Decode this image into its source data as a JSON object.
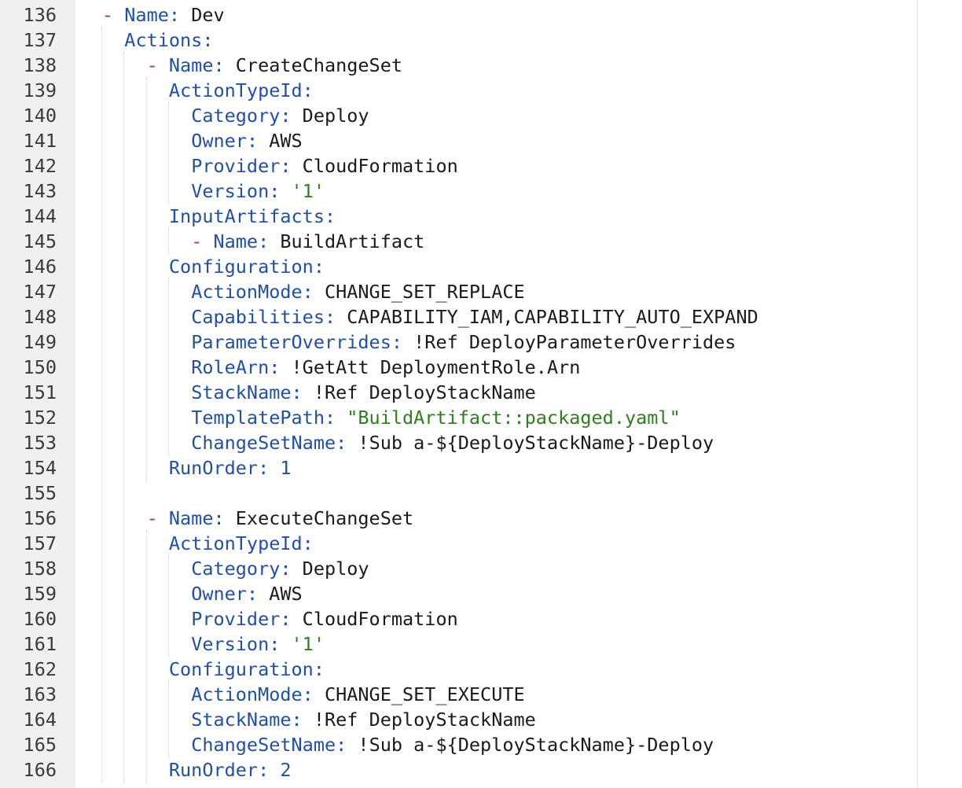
{
  "editor": {
    "lines": [
      {
        "number": "136",
        "indent": "",
        "dash": "- ",
        "key": "Name",
        "colon": ": ",
        "value": "Dev",
        "kind": "val"
      },
      {
        "number": "137",
        "indent": "  ",
        "dash": "",
        "key": "Actions",
        "colon": ":",
        "value": "",
        "kind": "val"
      },
      {
        "number": "138",
        "indent": "    ",
        "dash": "- ",
        "key": "Name",
        "colon": ": ",
        "value": "CreateChangeSet",
        "kind": "val"
      },
      {
        "number": "139",
        "indent": "      ",
        "dash": "",
        "key": "ActionTypeId",
        "colon": ":",
        "value": "",
        "kind": "val"
      },
      {
        "number": "140",
        "indent": "        ",
        "dash": "",
        "key": "Category",
        "colon": ": ",
        "value": "Deploy",
        "kind": "val"
      },
      {
        "number": "141",
        "indent": "        ",
        "dash": "",
        "key": "Owner",
        "colon": ": ",
        "value": "AWS",
        "kind": "val"
      },
      {
        "number": "142",
        "indent": "        ",
        "dash": "",
        "key": "Provider",
        "colon": ": ",
        "value": "CloudFormation",
        "kind": "val"
      },
      {
        "number": "143",
        "indent": "        ",
        "dash": "",
        "key": "Version",
        "colon": ": ",
        "value": "'1'",
        "kind": "str"
      },
      {
        "number": "144",
        "indent": "      ",
        "dash": "",
        "key": "InputArtifacts",
        "colon": ":",
        "value": "",
        "kind": "val"
      },
      {
        "number": "145",
        "indent": "        ",
        "dash": "- ",
        "key": "Name",
        "colon": ": ",
        "value": "BuildArtifact",
        "kind": "val"
      },
      {
        "number": "146",
        "indent": "      ",
        "dash": "",
        "key": "Configuration",
        "colon": ":",
        "value": "",
        "kind": "val"
      },
      {
        "number": "147",
        "indent": "        ",
        "dash": "",
        "key": "ActionMode",
        "colon": ": ",
        "value": "CHANGE_SET_REPLACE",
        "kind": "val"
      },
      {
        "number": "148",
        "indent": "        ",
        "dash": "",
        "key": "Capabilities",
        "colon": ": ",
        "value": "CAPABILITY_IAM,CAPABILITY_AUTO_EXPAND",
        "kind": "val"
      },
      {
        "number": "149",
        "indent": "        ",
        "dash": "",
        "key": "ParameterOverrides",
        "colon": ": ",
        "value": "!Ref DeployParameterOverrides",
        "kind": "val"
      },
      {
        "number": "150",
        "indent": "        ",
        "dash": "",
        "key": "RoleArn",
        "colon": ": ",
        "value": "!GetAtt DeploymentRole.Arn",
        "kind": "val"
      },
      {
        "number": "151",
        "indent": "        ",
        "dash": "",
        "key": "StackName",
        "colon": ": ",
        "value": "!Ref DeployStackName",
        "kind": "val"
      },
      {
        "number": "152",
        "indent": "        ",
        "dash": "",
        "key": "TemplatePath",
        "colon": ": ",
        "value": "\"BuildArtifact::packaged.yaml\"",
        "kind": "str"
      },
      {
        "number": "153",
        "indent": "        ",
        "dash": "",
        "key": "ChangeSetName",
        "colon": ": ",
        "value": "!Sub a-${DeployStackName}-Deploy",
        "kind": "val"
      },
      {
        "number": "154",
        "indent": "      ",
        "dash": "",
        "key": "RunOrder",
        "colon": ": ",
        "value": "1",
        "kind": "num"
      },
      {
        "number": "155",
        "indent": "",
        "dash": "",
        "key": "",
        "colon": "",
        "value": "",
        "kind": "val"
      },
      {
        "number": "156",
        "indent": "    ",
        "dash": "- ",
        "key": "Name",
        "colon": ": ",
        "value": "ExecuteChangeSet",
        "kind": "val"
      },
      {
        "number": "157",
        "indent": "      ",
        "dash": "",
        "key": "ActionTypeId",
        "colon": ":",
        "value": "",
        "kind": "val"
      },
      {
        "number": "158",
        "indent": "        ",
        "dash": "",
        "key": "Category",
        "colon": ": ",
        "value": "Deploy",
        "kind": "val"
      },
      {
        "number": "159",
        "indent": "        ",
        "dash": "",
        "key": "Owner",
        "colon": ": ",
        "value": "AWS",
        "kind": "val"
      },
      {
        "number": "160",
        "indent": "        ",
        "dash": "",
        "key": "Provider",
        "colon": ": ",
        "value": "CloudFormation",
        "kind": "val"
      },
      {
        "number": "161",
        "indent": "        ",
        "dash": "",
        "key": "Version",
        "colon": ": ",
        "value": "'1'",
        "kind": "str"
      },
      {
        "number": "162",
        "indent": "      ",
        "dash": "",
        "key": "Configuration",
        "colon": ":",
        "value": "",
        "kind": "val"
      },
      {
        "number": "163",
        "indent": "        ",
        "dash": "",
        "key": "ActionMode",
        "colon": ": ",
        "value": "CHANGE_SET_EXECUTE",
        "kind": "val"
      },
      {
        "number": "164",
        "indent": "        ",
        "dash": "",
        "key": "StackName",
        "colon": ": ",
        "value": "!Ref DeployStackName",
        "kind": "val"
      },
      {
        "number": "165",
        "indent": "        ",
        "dash": "",
        "key": "ChangeSetName",
        "colon": ": ",
        "value": "!Sub a-${DeployStackName}-Deploy",
        "kind": "val"
      },
      {
        "number": "166",
        "indent": "      ",
        "dash": "",
        "key": "RunOrder",
        "colon": ": ",
        "value": "2",
        "kind": "num"
      }
    ]
  }
}
